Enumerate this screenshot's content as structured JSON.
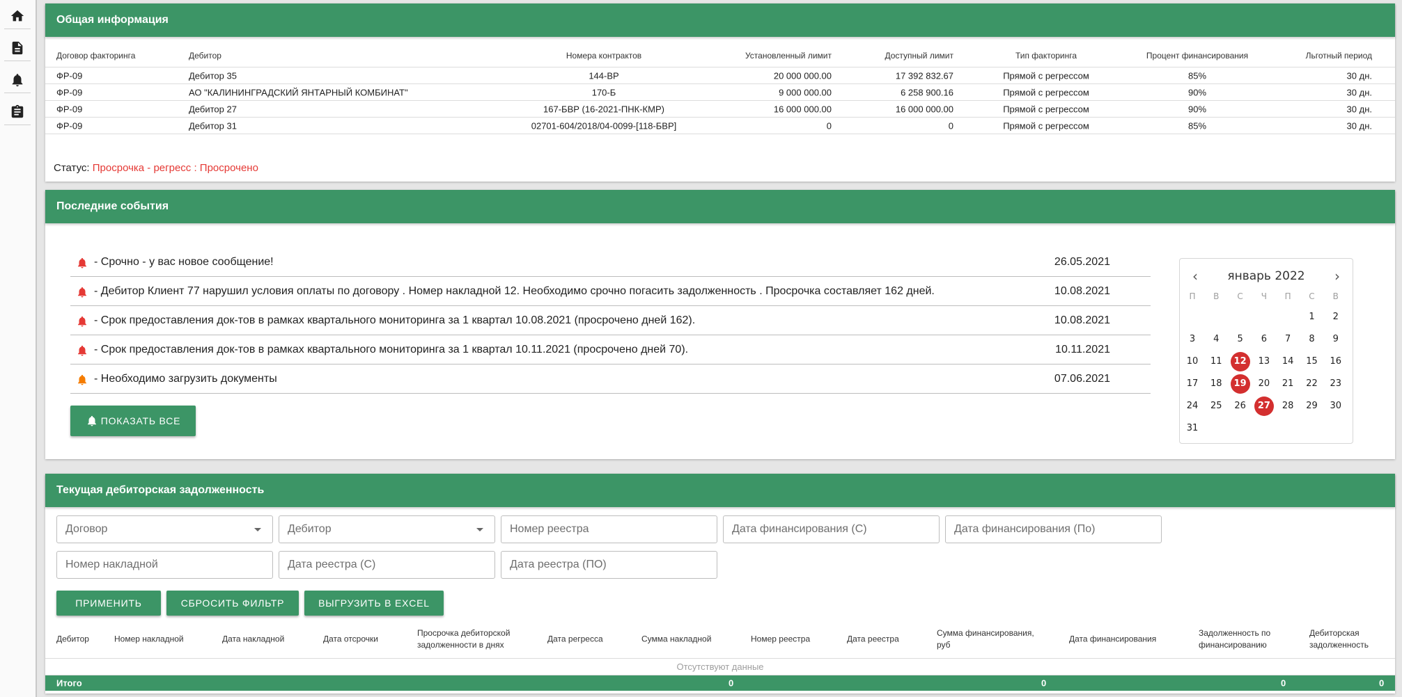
{
  "general": {
    "title": "Общая информация",
    "columns": [
      "Договор факторинга",
      "Дебитор",
      "Номера контрактов",
      "Установленный лимит",
      "Доступный лимит",
      "Тип факторинга",
      "Процент финансирования",
      "Льготный период"
    ],
    "rows": [
      [
        "ФР-09",
        "Дебитор 35",
        "144-ВР",
        "20 000 000.00",
        "17 392 832.67",
        "Прямой с регрессом",
        "85%",
        "30 дн."
      ],
      [
        "ФР-09",
        "АО \"КАЛИНИНГРАДСКИЙ ЯНТАРНЫЙ КОМБИНАТ\"",
        "170-Б",
        "9 000 000.00",
        "6 258 900.16",
        "Прямой с регрессом",
        "90%",
        "30 дн."
      ],
      [
        "ФР-09",
        "Дебитор 27",
        "167-БВР (16-2021-ПНК-КМР)",
        "16 000 000.00",
        "16 000 000.00",
        "Прямой с регрессом",
        "90%",
        "30 дн."
      ],
      [
        "ФР-09",
        "Дебитор 31",
        "02701-604/2018/04-0099-[118-БВР]",
        "0",
        "0",
        "Прямой с регрессом",
        "85%",
        "30 дн."
      ]
    ],
    "status_label": "Статус:",
    "status_value": "Просрочка - регресс : Просрочено"
  },
  "events": {
    "title": "Последние события",
    "items": [
      {
        "text": "- Срочно - у вас новое сообщение!",
        "date": "26.05.2021",
        "color": "#e53935"
      },
      {
        "text": "- Дебитор Клиент 77 нарушил условия оплаты по договору . Номер накладной 12. Необходимо срочно погасить задолженность . Просрочка составляет 162 дней.",
        "date": "10.08.2021",
        "color": "#e53935"
      },
      {
        "text": "- Срок предоставления док-тов в рамках квартального мониторинга за 1 квартал 10.08.2021 (просрочено дней 162).",
        "date": "10.08.2021",
        "color": "#e53935"
      },
      {
        "text": "- Срок предоставления док-тов в рамках квартального мониторинга за 1 квартал 10.11.2021 (просрочено дней 70).",
        "date": "10.11.2021",
        "color": "#e53935"
      },
      {
        "text": "- Необходимо загрузить документы",
        "date": "07.06.2021",
        "color": "#f57c00"
      }
    ],
    "show_all": "ПОКАЗАТЬ ВСЕ"
  },
  "calendar": {
    "title": "январь 2022",
    "prev": "‹",
    "next": "›",
    "weekdays": [
      "П",
      "В",
      "С",
      "Ч",
      "П",
      "С",
      "В"
    ],
    "first_weekday": 5,
    "days": 31,
    "marked": [
      12,
      19,
      27
    ]
  },
  "debt": {
    "title": "Текущая дебиторская задолженность",
    "filters": {
      "contract": "Договор",
      "debtor": "Дебитор",
      "registry_no": "Номер реестра",
      "fin_date_from": "Дата финансирования (С)",
      "fin_date_to": "Дата финансирования (По)",
      "invoice_no": "Номер накладной",
      "reg_date_from": "Дата реестра (С)",
      "reg_date_to": "Дата реестра (ПО)"
    },
    "buttons": {
      "apply": "ПРИМЕНИТЬ",
      "reset": "СБРОСИТЬ ФИЛЬТР",
      "export": "ВЫГРУЗИТЬ В EXCEL"
    },
    "columns": [
      "Дебитор",
      "Номер накладной",
      "Дата накладной",
      "Дата отсрочки",
      "Просрочка дебиторской задолженности в днях",
      "Дата регресса",
      "Сумма накладной",
      "Номер реестра",
      "Дата реестра",
      "Сумма финансирования, руб",
      "Дата финансирования",
      "Задолженность по финансированию",
      "Дебиторская задолженность"
    ],
    "no_data": "Отсутствуют данные",
    "total_label": "Итого",
    "totals": [
      "0",
      "0",
      "0",
      "0"
    ]
  }
}
